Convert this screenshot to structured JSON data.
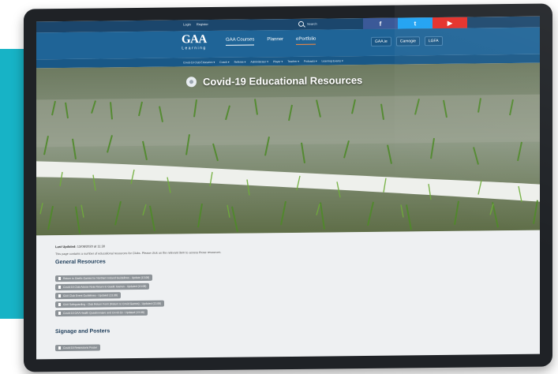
{
  "topbar": {
    "login": "Login",
    "register": "Register",
    "search_placeholder": "Search",
    "social": {
      "facebook": "f",
      "twitter": "t",
      "youtube": "▶"
    }
  },
  "logo": {
    "mark": "GAA",
    "text": "Learning"
  },
  "nav": [
    {
      "label": "GAA Courses"
    },
    {
      "label": "Planner"
    },
    {
      "label": "ePortfolio"
    }
  ],
  "pills": [
    "GAA.ie",
    "Camogie",
    "LGFA"
  ],
  "subnav": [
    "Covid-19 Club Education ▾",
    "Coach ▾",
    "Referee ▾",
    "Administrator ▾",
    "Player ▾",
    "Teacher ▾",
    "Podcasts ▾",
    "Learning Events ▾"
  ],
  "hero": {
    "title": "Covid-19 Educational Resources"
  },
  "content": {
    "updated_label": "Last Updated:",
    "updated_value": "13/08/2020 at 11:30",
    "description": "This page contains a number of educational resources for Clubs. Please click on the relevant item to access those resources.",
    "general_heading": "General Resources",
    "general_items": [
      "Return to Gaelic Games for Northern Ireland Guidelines - Update (13.08)",
      "Covid-19 Club Advice Note Return to Gaelic Games - Updated (13.08)",
      "GAA Club Event Guidelines - Updated (13.08)",
      "GAA Safeguarding - Club Return Form (Return to Covid Games) - Updated (13.08)",
      "Covid-19 GAA Health Questionnaire and Covid-19 - Updated (13.08)"
    ],
    "signage_heading": "Signage and Posters",
    "signage_items": [
      "Covid-19 Restrictions Poster"
    ]
  }
}
